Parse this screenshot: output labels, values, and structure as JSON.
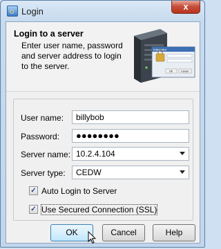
{
  "window": {
    "title": "Login",
    "close_label": "x"
  },
  "header": {
    "title": "Login to a server",
    "description": "Enter user name, password and server address to login to the server."
  },
  "form": {
    "username": {
      "label": "User name:",
      "value": "billybob"
    },
    "password": {
      "label": "Password:",
      "value": "●●●●●●●●"
    },
    "server_name": {
      "label": "Server name:",
      "value": "10.2.4.104"
    },
    "server_type": {
      "label": "Server type:",
      "value": "CEDW"
    },
    "auto_login": {
      "label": "Auto Login to Server",
      "checked": true
    },
    "ssl": {
      "label": "Use Secured Connection (SSL)",
      "checked": true
    }
  },
  "buttons": {
    "ok": "OK",
    "cancel": "Cancel",
    "help": "Help"
  },
  "illustration": {
    "dialog_title": "Integrator",
    "ok_label": "OK",
    "cancel_label": "Cancel"
  }
}
